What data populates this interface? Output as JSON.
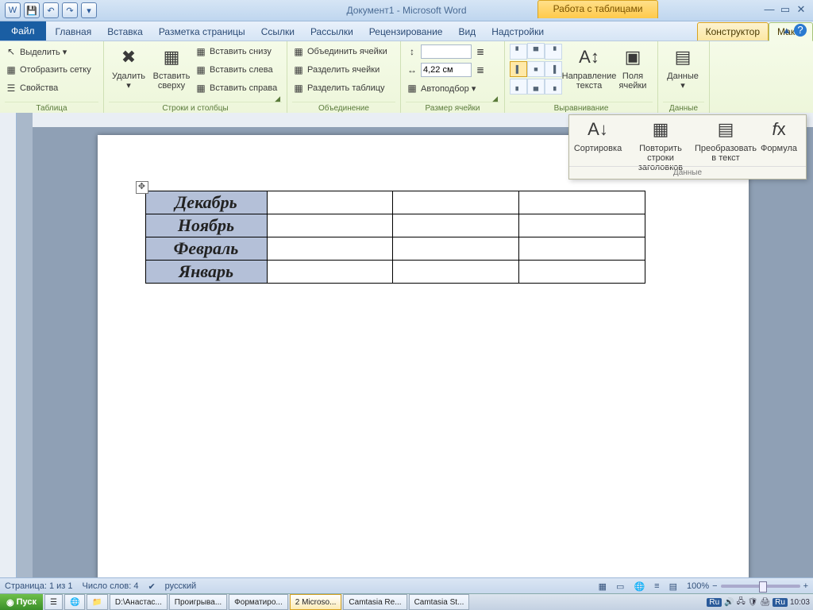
{
  "title": "Документ1  -  Microsoft Word",
  "table_tools_title": "Работа с таблицами",
  "window_buttons": {
    "min": "—",
    "max": "▭",
    "close": "✕",
    "ribmin": "▴",
    "help": "?"
  },
  "tabs": {
    "file": "Файл",
    "home": "Главная",
    "insert": "Вставка",
    "page_layout": "Разметка страницы",
    "references": "Ссылки",
    "mailings": "Рассылки",
    "review": "Рецензирование",
    "view": "Вид",
    "addins": "Надстройки",
    "design": "Конструктор",
    "layout": "Макет"
  },
  "ribbon": {
    "table_group": "Таблица",
    "select": "Выделить ▾",
    "gridlines": "Отобразить сетку",
    "properties": "Свойства",
    "rows_cols_group": "Строки и столбцы",
    "delete": "Удалить",
    "delete_dd": "▾",
    "insert_above": "Вставить сверху",
    "insert_below": "Вставить снизу",
    "insert_left": "Вставить слева",
    "insert_right": "Вставить справа",
    "merge_group": "Объединение",
    "merge": "Объединить ячейки",
    "split": "Разделить ячейки",
    "split_table": "Разделить таблицу",
    "cellsize_group": "Размер ячейки",
    "height": "",
    "width": "4,22 см",
    "autofit": "Автоподбор ▾",
    "distribute_rows": "≣",
    "distribute_cols": "≣",
    "align_group": "Выравнивание",
    "text_direction": "Направление текста",
    "cell_margins": "Поля ячейки",
    "data_group": "Данные",
    "data_btn": "Данные",
    "flyout": {
      "sort": "Сортировка",
      "repeat": "Повторить строки заголовков",
      "convert": "Преобразовать в текст",
      "formula": "Формула",
      "label": "Данные"
    }
  },
  "table_rows": [
    "Декабрь",
    "Ноябрь",
    "Февраль",
    "Январь"
  ],
  "status": {
    "page": "Страница: 1 из 1",
    "words": "Число слов: 4",
    "lang": "русский",
    "zoom": "100%"
  },
  "taskbar": {
    "start": "Пуск",
    "items": [
      "D:\\Анастас...",
      "Проигрыва...",
      "Форматиро...",
      "2 Microso...",
      "Camtasia Re...",
      "Camtasia St..."
    ],
    "active_index": 3,
    "lang": "Ru",
    "clock": "10:03"
  }
}
